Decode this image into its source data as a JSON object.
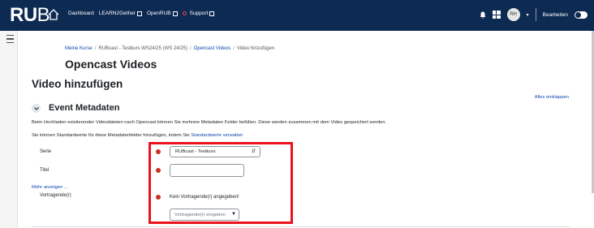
{
  "brand": {
    "logo_bold": "RU",
    "logo_thin": "B"
  },
  "nav": {
    "dashboard": "Dashboard",
    "learn2gether": "LEARN2Gether",
    "openrub": "OpenRUB",
    "support": "Support",
    "user_initials": "RH",
    "edit_mode": "Bearbeiten"
  },
  "breadcrumb": {
    "item1": "Meine Kurse",
    "item2": "RUBcast - Testkurs WS24/25 (WS 24/25)",
    "item3": "Opencast Videos",
    "item4": "Video hinzufügen"
  },
  "course_title": "Opencast Videos",
  "page_title": "Video hinzufügen",
  "collapse_all": "Alles einklappen",
  "section": {
    "title": "Event Metadaten",
    "description": "Beim Hochladen existierender Videodateien nach Opencast können Sie mehrere Metadaten Felder befüllen. Diese werden zusammen mit dem Video gespeichert werden.",
    "defaults_text": "Sie können Standardwerte für diese Metadatenfelder hinzufügen, indem Sie ",
    "defaults_link": "Standardwerte verwalten"
  },
  "form": {
    "series_label": "Serie",
    "series_value": "RUBcast - Testkurs",
    "title_label": "Titel",
    "title_value": "",
    "more_link": "Mehr anzeigen ...",
    "speakers_label": "Vortragende(r)",
    "speakers_message": "Kein Vortragende(r) angegeben!",
    "speakers_placeholder": "Vortragende(r) eingeben"
  },
  "colors": {
    "navbar": "#0d2a52",
    "link": "#0f47ad",
    "required": "#ca3120",
    "highlight": "#e8141c"
  }
}
